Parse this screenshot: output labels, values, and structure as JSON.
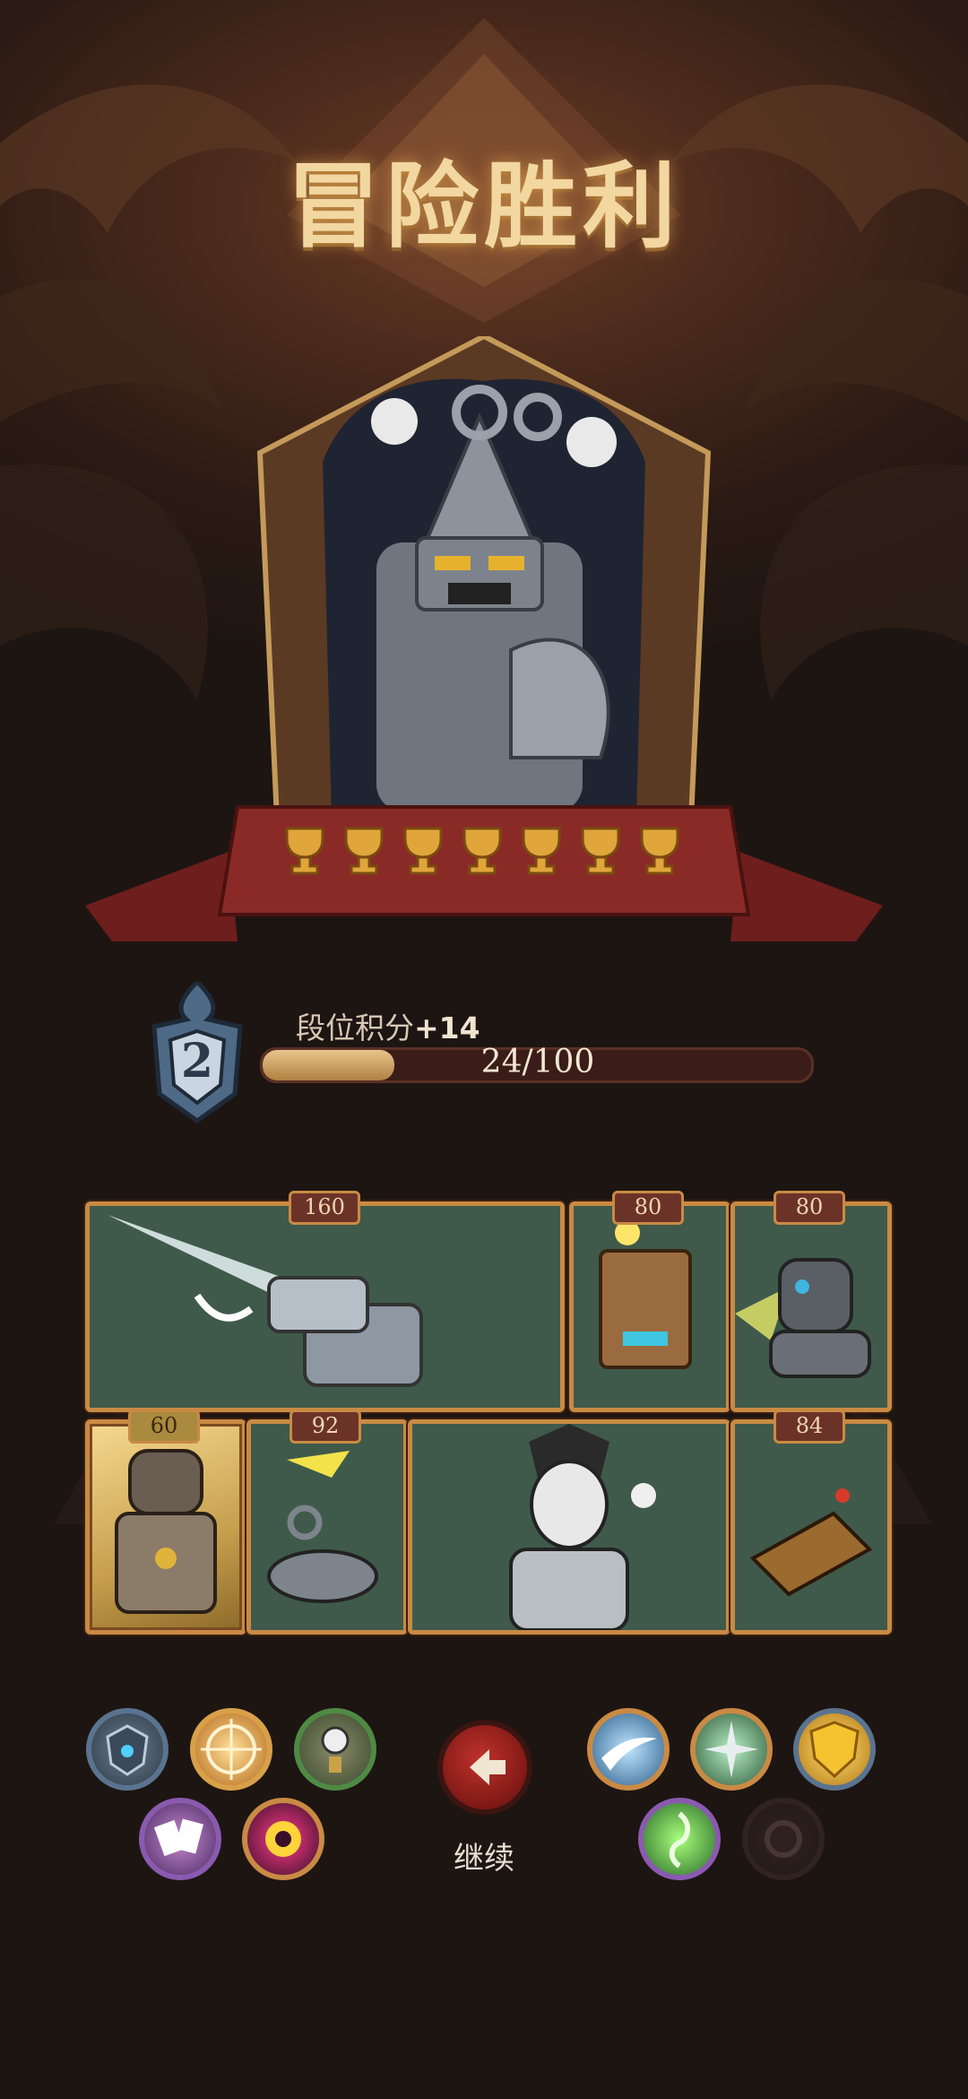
{
  "title": "冒险胜利",
  "hero": {
    "name_icon": "wind-up-knight-portrait",
    "trophies": 7
  },
  "rank": {
    "level": "2",
    "points_label": "段位积分",
    "points_gain": "+14",
    "progress_text": "24/100",
    "progress_fraction": 0.24
  },
  "cards_row1": [
    {
      "cost": "160",
      "icon": "steam-cannon-card"
    },
    {
      "cost": "80",
      "icon": "box-robot-card"
    },
    {
      "cost": "80",
      "icon": "mech-dog-card"
    }
  ],
  "cards_row2": [
    {
      "cost": "60",
      "icon": "armored-knight-card"
    },
    {
      "cost": "92",
      "icon": "wind-up-mouse-card"
    },
    {
      "cost": "",
      "icon": "skull-queen-card"
    },
    {
      "cost": "84",
      "icon": "clockwork-rat-card"
    }
  ],
  "left_skills": [
    "shield-crest-icon",
    "target-burst-icon",
    "pocket-watch-icon",
    "playing-cards-icon",
    "vortex-eye-icon"
  ],
  "right_skills": [
    "ice-slash-icon",
    "spike-burst-icon",
    "golden-shield-icon",
    "green-rune-icon",
    "locked-skill-icon"
  ],
  "continue": {
    "label": "继续",
    "icon": "arrow-left-icon"
  },
  "colors": {
    "accent": "#c98a44",
    "bar_fill": "#d9b174",
    "continue_red": "#b02a25"
  }
}
